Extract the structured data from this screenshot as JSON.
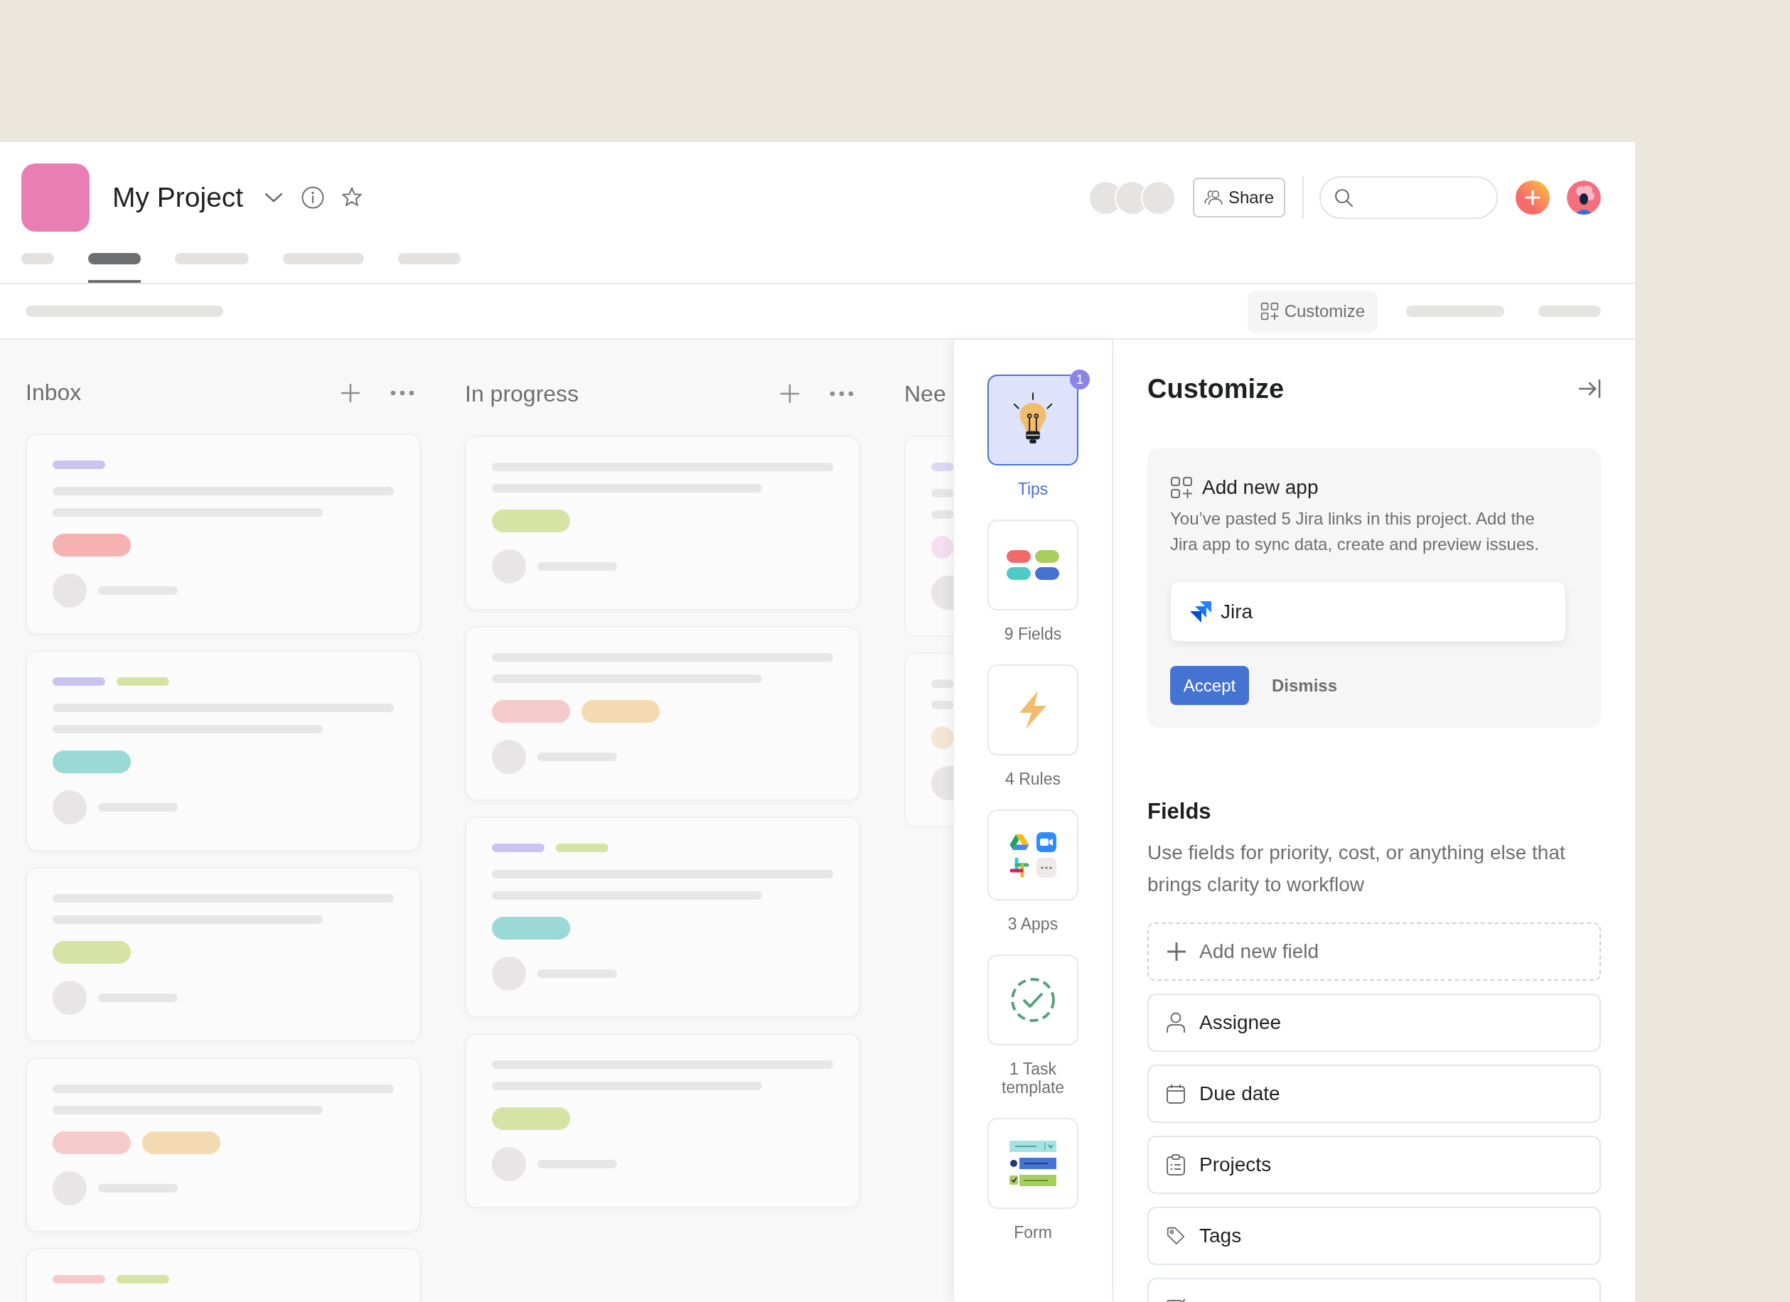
{
  "header": {
    "title": "My Project",
    "tabs": [
      {
        "selected": false
      },
      {
        "selected": true
      },
      {
        "selected": false
      },
      {
        "selected": false
      },
      {
        "selected": false
      }
    ],
    "share_button": "Share"
  },
  "toolbar": {
    "customize_button": "Customize"
  },
  "board": {
    "columns": [
      {
        "title": "Inbox",
        "cards": [
          {
            "labels": [
              {
                "color": "#c9c3ef"
              }
            ],
            "pills": [
              {
                "color": "#f6b1b1"
              }
            ]
          },
          {
            "labels": [
              {
                "color": "#c9c3ef"
              },
              {
                "color": "#d5e4a4"
              }
            ],
            "pills": [
              {
                "color": "#9ad9d5"
              }
            ]
          },
          {
            "pills": [
              {
                "color": "#d5e4a4"
              }
            ]
          },
          {
            "pills": [
              {
                "color": "#f5cacb"
              },
              {
                "color": "#f4dab0"
              }
            ]
          },
          {
            "labels": [
              {
                "color": "#f5cacb"
              },
              {
                "color": "#d5e4a4"
              }
            ]
          }
        ]
      },
      {
        "title": "In progress",
        "cards": [
          {
            "pills": [
              {
                "color": "#d5e4a4"
              }
            ]
          },
          {
            "pills": [
              {
                "color": "#f5cacb"
              },
              {
                "color": "#f4dab0"
              }
            ]
          },
          {
            "labels": [
              {
                "color": "#c9c3ef"
              },
              {
                "color": "#d5e4a4"
              }
            ],
            "pills": [
              {
                "color": "#9ad9d5"
              }
            ]
          },
          {
            "pills": [
              {
                "color": "#d5e4a4"
              }
            ]
          }
        ]
      },
      {
        "title": "Nee",
        "cards": [
          {
            "labels": [
              {
                "color": "#dcd8f4"
              }
            ],
            "pills": [
              {
                "color": "#f4dff0"
              }
            ]
          },
          {
            "pills": [
              {
                "color": "#f4e6d4"
              }
            ]
          }
        ]
      }
    ]
  },
  "rail": {
    "items": [
      {
        "label": "Tips",
        "kind": "tips",
        "selected": true,
        "badge": "1"
      },
      {
        "label": "9 Fields",
        "kind": "fields",
        "selected": false
      },
      {
        "label": "4 Rules",
        "kind": "rules",
        "selected": false
      },
      {
        "label": "3 Apps",
        "kind": "apps",
        "selected": false
      },
      {
        "label": "1 Task template",
        "kind": "template",
        "selected": false
      },
      {
        "label": "Form",
        "kind": "form",
        "selected": false
      }
    ]
  },
  "customize_panel": {
    "title": "Customize",
    "app_suggestion": {
      "title": "Add new app",
      "text": "You’ve pasted 5 Jira links in this project. Add the Jira app to sync data, create and preview issues.",
      "app_name": "Jira",
      "accept_button": "Accept",
      "dismiss_button": "Dismiss"
    },
    "fields_section": {
      "title": "Fields",
      "description": "Use fields for priority, cost, or anything else that brings clarity to workflow",
      "add_field_button": "Add new field",
      "fields": [
        {
          "label": "Assignee",
          "kind": "person"
        },
        {
          "label": "Due date",
          "kind": "date"
        },
        {
          "label": "Projects",
          "kind": "projects"
        },
        {
          "label": "Tags",
          "kind": "tags"
        },
        {
          "kind": "note"
        }
      ]
    }
  }
}
